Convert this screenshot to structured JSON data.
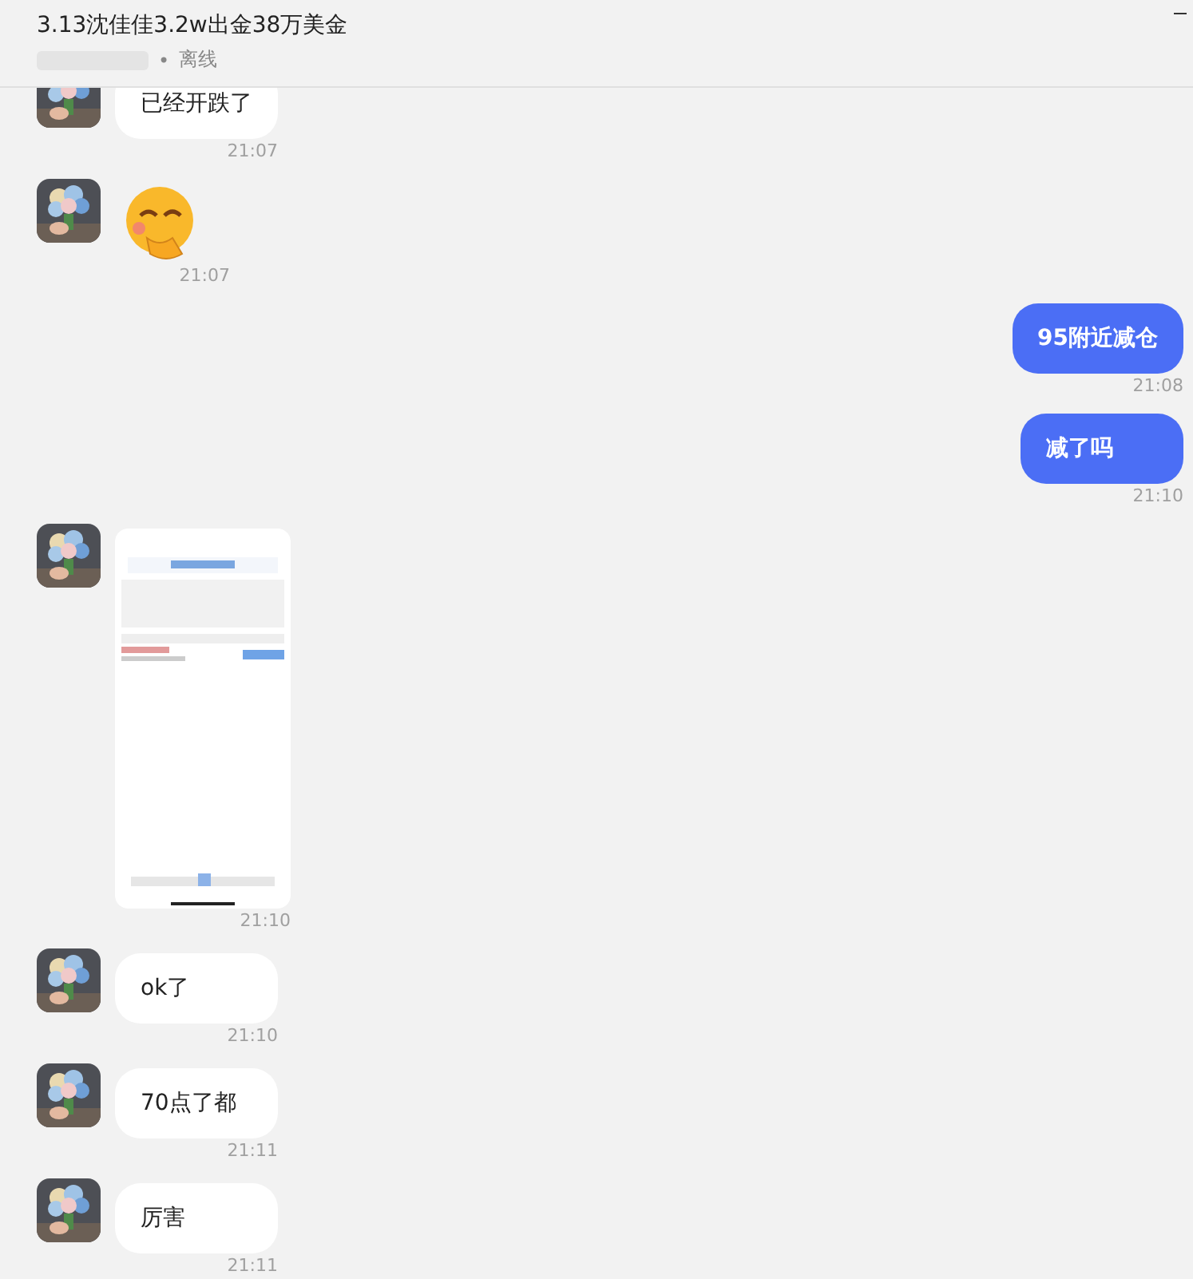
{
  "header": {
    "title": "3.13沈佳佳3.2w出金38万美金",
    "separator": "•",
    "status": "离线"
  },
  "messages": [
    {
      "outgoing": false,
      "kind": "text",
      "text": "已经开跌了",
      "time": "21:07"
    },
    {
      "outgoing": false,
      "kind": "emoji",
      "time": "21:07"
    },
    {
      "outgoing": true,
      "kind": "text",
      "text": "95附近减仓",
      "time": "21:08"
    },
    {
      "outgoing": true,
      "kind": "text",
      "text": "减了吗",
      "time": "21:10"
    },
    {
      "outgoing": false,
      "kind": "picture",
      "time": "21:10"
    },
    {
      "outgoing": false,
      "kind": "text",
      "text": "ok了",
      "time": "21:10"
    },
    {
      "outgoing": false,
      "kind": "text",
      "text": "70点了都",
      "time": "21:11"
    },
    {
      "outgoing": false,
      "kind": "text",
      "text": "厉害",
      "time": "21:11"
    }
  ]
}
